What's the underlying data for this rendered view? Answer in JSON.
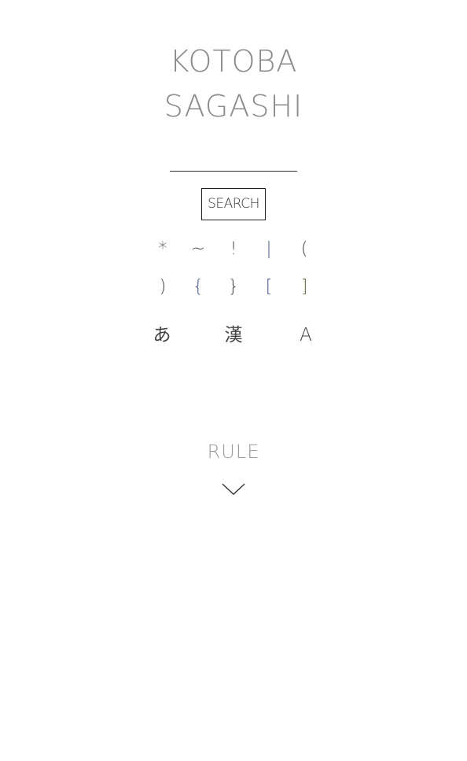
{
  "header": {
    "title_line1": "KOTOBA",
    "title_line2": "SAGASHI"
  },
  "search": {
    "value": "",
    "placeholder": "",
    "button_label": "SEARCH"
  },
  "symbols": {
    "row1": [
      "*",
      "~",
      "!",
      "|",
      "("
    ],
    "row2": [
      ")",
      "{",
      "}",
      "[",
      "]"
    ]
  },
  "modes": {
    "hiragana": "あ",
    "kanji": "漢",
    "alphabet": "A"
  },
  "rule": {
    "label": "RULE",
    "toggle_icon": "chevron-down-icon"
  },
  "colors": {
    "title": "#8a8a8a",
    "text": "#333333",
    "rule": "#9a9a9a"
  }
}
